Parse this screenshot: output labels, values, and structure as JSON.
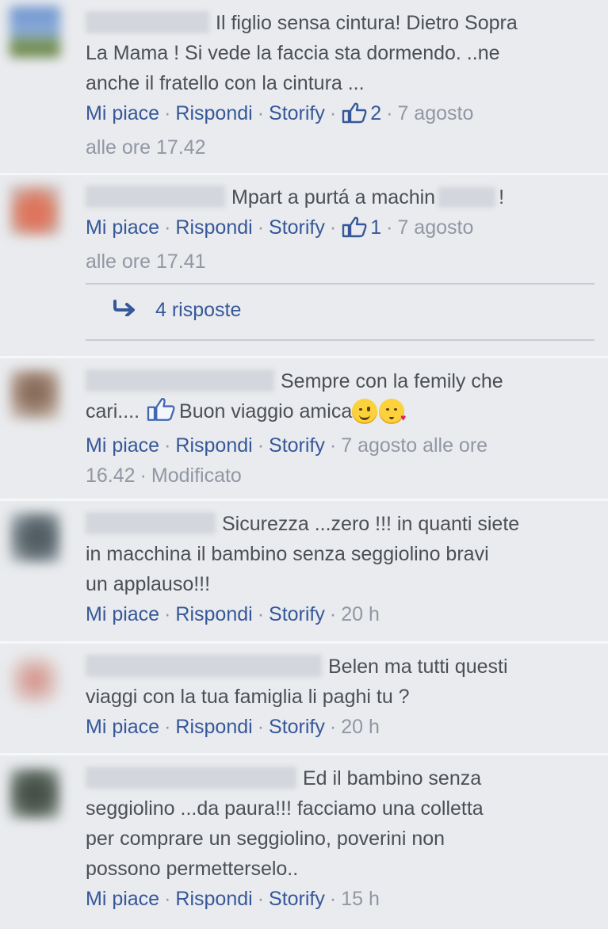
{
  "colors": {
    "background": "#e9ebee",
    "link": "#365899",
    "meta": "#9197a3",
    "text": "#4b4f56"
  },
  "comments": [
    {
      "text_lines": [
        "Il figlio sensa cintura! Dietro Sopra",
        "La Mama ! Si vede la faccia sta dormendo. ..ne",
        "anche il fratello con la cintura ..."
      ],
      "like_label": "Mi piace",
      "reply_label": "Rispondi",
      "storify_label": "Storify",
      "like_count": "2",
      "time_line1": "7 agosto",
      "time_line2": "alle ore 17.42"
    },
    {
      "text_before": "Mpart a purtá a machin",
      "text_after": "!",
      "like_label": "Mi piace",
      "reply_label": "Rispondi",
      "storify_label": "Storify",
      "like_count": "1",
      "time_line1": "7 agosto",
      "time_line2": "alle ore 17.41",
      "replies_label": "4 risposte"
    },
    {
      "text_line1": "Sempre con la femily che",
      "text_line2_a": "cari....",
      "text_line2_b": "Buon viaggio amica",
      "like_label": "Mi piace",
      "reply_label": "Rispondi",
      "storify_label": "Storify",
      "time_line1": "7 agosto alle ore",
      "time_line2": "16.42",
      "edited_label": "Modificato"
    },
    {
      "text_lines": [
        "Sicurezza ...zero !!! in quanti siete",
        "in macchina il bambino senza seggiolino bravi",
        "un applauso!!!"
      ],
      "like_label": "Mi piace",
      "reply_label": "Rispondi",
      "storify_label": "Storify",
      "time": "20 h"
    },
    {
      "text_lines": [
        "Belen ma tutti questi",
        "viaggi con la tua famiglia li paghi tu ?"
      ],
      "like_label": "Mi piace",
      "reply_label": "Rispondi",
      "storify_label": "Storify",
      "time": "20 h"
    },
    {
      "text_lines": [
        "Ed il bambino senza",
        "seggiolino ...da paura!!! facciamo una colletta",
        "per comprare un seggiolino, poverini non",
        "possono permetterselo.."
      ],
      "like_label": "Mi piace",
      "reply_label": "Rispondi",
      "storify_label": "Storify",
      "time": "15 h"
    }
  ],
  "icons": {
    "like": "thumbs-up-icon",
    "reply_arrow": "reply-arrow-icon",
    "wink_emoji": "wink-emoji-icon",
    "kiss_emoji": "kiss-emoji-icon"
  },
  "separator": "·"
}
